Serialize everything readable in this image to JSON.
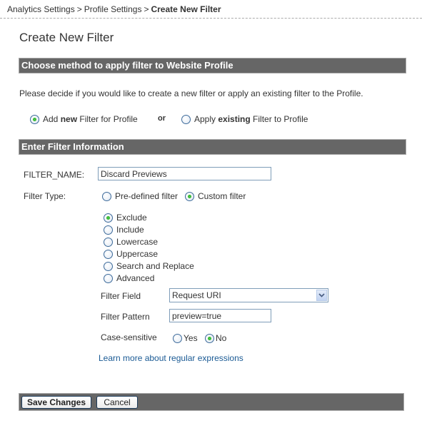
{
  "breadcrumb": {
    "items": [
      "Analytics Settings",
      "Profile Settings"
    ],
    "separator": ">",
    "current": "Create New Filter"
  },
  "page_title": "Create New Filter",
  "method_section": {
    "header": "Choose method to apply filter to Website Profile",
    "intro": "Please decide if you would like to create a new filter or apply an existing filter to the Profile.",
    "options": [
      {
        "prefix": "Add ",
        "bold": "new",
        "suffix": " Filter for Profile",
        "checked": true
      },
      {
        "prefix": "Apply ",
        "bold": "existing",
        "suffix": " Filter to Profile",
        "checked": false
      }
    ],
    "or_label": "or"
  },
  "filter_section": {
    "header": "Enter Filter Information",
    "filter_name_label": "FILTER_NAME:",
    "filter_name_value": "Discard Previews",
    "filter_type_label": "Filter Type:",
    "filter_type_options": [
      {
        "label": "Pre-defined filter",
        "checked": false
      },
      {
        "label": "Custom filter",
        "checked": true
      }
    ],
    "custom_options": [
      {
        "label": "Exclude",
        "checked": true
      },
      {
        "label": "Include",
        "checked": false
      },
      {
        "label": "Lowercase",
        "checked": false
      },
      {
        "label": "Uppercase",
        "checked": false
      },
      {
        "label": "Search and Replace",
        "checked": false
      },
      {
        "label": "Advanced",
        "checked": false
      }
    ],
    "filter_field_label": "Filter Field",
    "filter_field_value": "Request URI",
    "filter_pattern_label": "Filter Pattern",
    "filter_pattern_value": "preview=true",
    "case_sensitive_label": "Case-sensitive",
    "case_options": [
      {
        "label": "Yes",
        "checked": false
      },
      {
        "label": "No",
        "checked": true
      }
    ],
    "learn_more_link": "Learn more about regular expressions"
  },
  "footer": {
    "save_label": "Save Changes",
    "cancel_label": "Cancel"
  },
  "colors": {
    "section_bar": "#666666",
    "link": "#1a5a94",
    "radio_selected": "#22a11d",
    "input_border": "#7f9db9"
  },
  "icons": {
    "select_arrow": "chevron-down-icon"
  }
}
